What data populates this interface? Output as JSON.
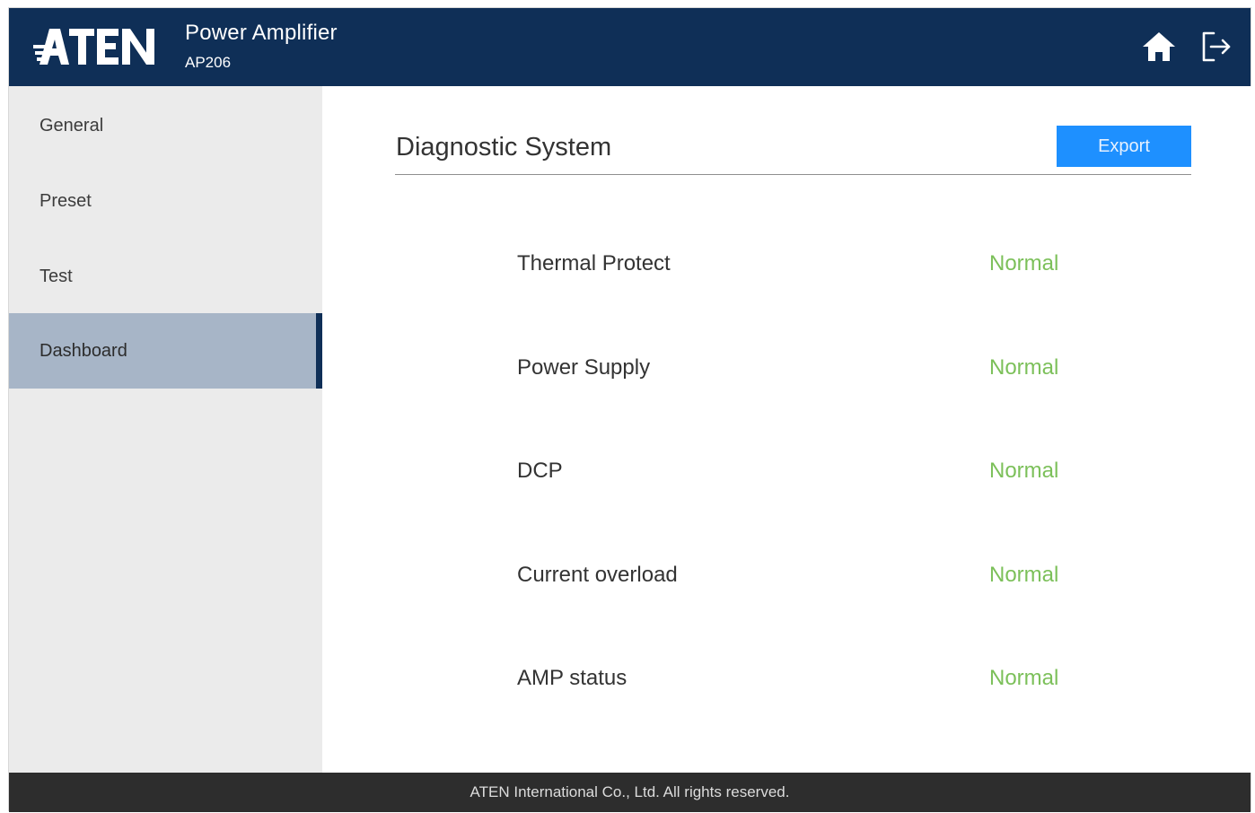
{
  "header": {
    "brand": "ATEN",
    "product_title": "Power Amplifier",
    "product_model": "AP206",
    "icons": {
      "home": "home-icon",
      "logout": "logout-icon"
    }
  },
  "sidebar": {
    "items": [
      {
        "label": "General",
        "active": false
      },
      {
        "label": "Preset",
        "active": false
      },
      {
        "label": "Test",
        "active": false
      },
      {
        "label": "Dashboard",
        "active": true
      }
    ]
  },
  "main": {
    "title": "Diagnostic System",
    "export_label": "Export",
    "diagnostics": [
      {
        "label": "Thermal Protect",
        "status": "Normal"
      },
      {
        "label": "Power Supply",
        "status": "Normal"
      },
      {
        "label": "DCP",
        "status": "Normal"
      },
      {
        "label": "Current overload",
        "status": "Normal"
      },
      {
        "label": "AMP status",
        "status": "Normal"
      }
    ]
  },
  "footer": {
    "copyright": "ATEN International Co., Ltd. All rights reserved."
  },
  "colors": {
    "header_bg": "#0f2f57",
    "accent_button": "#1e90ff",
    "status_normal": "#7cc05a",
    "active_nav": "#a7b5c7",
    "footer_bg": "#2d2d2d"
  }
}
